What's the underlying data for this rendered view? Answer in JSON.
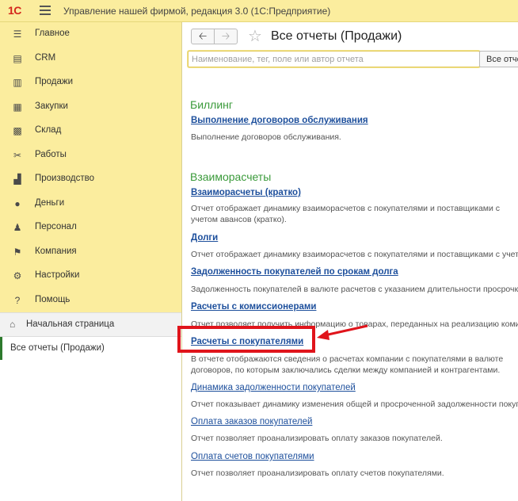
{
  "titlebar": {
    "logo": "1С",
    "title": "Управление нашей фирмой, редакция 3.0  (1С:Предприятие)"
  },
  "sidebar": {
    "items": [
      {
        "label": "Главное",
        "icon": "menu-lines-icon"
      },
      {
        "label": "CRM",
        "icon": "contacts-card-icon"
      },
      {
        "label": "Продажи",
        "icon": "basket-icon"
      },
      {
        "label": "Закупки",
        "icon": "cart-icon"
      },
      {
        "label": "Склад",
        "icon": "warehouse-icon"
      },
      {
        "label": "Работы",
        "icon": "tools-icon"
      },
      {
        "label": "Производство",
        "icon": "factory-icon"
      },
      {
        "label": "Деньги",
        "icon": "coin-icon"
      },
      {
        "label": "Персонал",
        "icon": "people-icon"
      },
      {
        "label": "Компания",
        "icon": "flag-icon"
      },
      {
        "label": "Настройки",
        "icon": "gear-icon"
      },
      {
        "label": "Помощь",
        "icon": "question-icon"
      }
    ],
    "home_label": "Начальная страница",
    "open_tab": "Все отчеты (Продажи)"
  },
  "main": {
    "title": "Все отчеты (Продажи)",
    "search_placeholder": "Наименование, тег, поле или автор отчета",
    "all_button": "Все отчеты",
    "groups": [
      {
        "title": "Биллинг",
        "reports": [
          {
            "name": "Выполнение договоров обслуживания",
            "desc": "Выполнение договоров обслуживания."
          }
        ]
      },
      {
        "title": "Взаиморасчеты",
        "reports": [
          {
            "name": "Взаиморасчеты (кратко)",
            "desc": "Отчет отображает динамику взаиморасчетов с покупателями и поставщиками с учетом авансов (кратко)."
          },
          {
            "name": "Долги",
            "desc": "Отчет отображает динамику взаиморасчетов с покупателями и поставщиками с учетом авансов."
          },
          {
            "name": "Задолженность покупателей по срокам долга",
            "desc": "Задолженность покупателей в валюте расчетов с указанием длительности просрочки."
          },
          {
            "name": "Расчеты с комиссионерами",
            "desc": "Отчет позволяет получить информацию о товарах, переданных на реализацию комиссионерам."
          },
          {
            "name": "Расчеты с покупателями",
            "desc": "В отчете отображаются сведения о расчетах компании с покупателями в валюте договоров, по которым заключались сделки между компанией и контрагентами."
          },
          {
            "name": "Динамика задолженности покупателей",
            "desc": "Отчет показывает динамику изменения общей и просроченной задолженности покупателей."
          },
          {
            "name": "Оплата заказов покупателей",
            "desc": "Отчет позволяет проанализировать оплату заказов покупателей."
          },
          {
            "name": "Оплата счетов покупателями",
            "desc": "Отчет позволяет проанализировать оплату счетов покупателями."
          }
        ]
      }
    ]
  },
  "colors": {
    "accent_yellow": "#fbed9e",
    "group_green": "#3a9a3a",
    "link_blue": "#1d4f9c",
    "annotation_red": "#e0141b"
  }
}
